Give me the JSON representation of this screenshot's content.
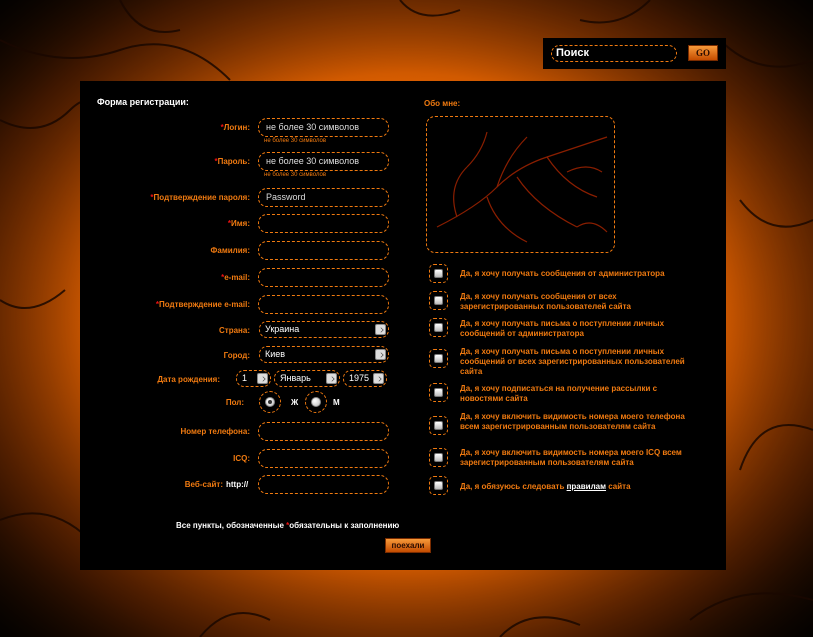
{
  "search": {
    "value": "Поиск",
    "go_label": "GO"
  },
  "form": {
    "title": "Форма регистрации:",
    "login": {
      "label": "Логин:",
      "placeholder": "не более 30 символов",
      "hint": "не более 30 символов"
    },
    "password": {
      "label": "Пароль:",
      "placeholder": "не более 30 символов",
      "hint": "не более 30 символов"
    },
    "password_confirm": {
      "label": "Подтверждение пароля:",
      "value": "Password"
    },
    "name": {
      "label": "Имя:"
    },
    "surname": {
      "label": "Фамилия:"
    },
    "email": {
      "label": "e-mail:"
    },
    "email_confirm": {
      "label": "Подтверждение e-mail:"
    },
    "country": {
      "label": "Страна:",
      "value": "Украина"
    },
    "city": {
      "label": "Город:",
      "value": "Киев"
    },
    "birthdate": {
      "label": "Дата рождения:",
      "day": "1",
      "month": "Январь",
      "year": "1975"
    },
    "gender": {
      "label": "Пол:",
      "female": "Ж",
      "male": "М",
      "selected": "female"
    },
    "phone": {
      "label": "Номер телефона:"
    },
    "icq": {
      "label": "ICQ:"
    },
    "website": {
      "label": "Веб-сайт:",
      "prefix": "http://"
    },
    "required_star": "*",
    "required_note_before": "Все пункты, обозначенные ",
    "required_note_after": "обязательны к заполнению",
    "submit_label": "поехали"
  },
  "about": {
    "label": "Обо мне:"
  },
  "options": [
    "Да, я хочу получать сообщения от администратора",
    "Да, я хочу получать сообщения от всех зарегистрированных пользователей сайта",
    "Да, я хочу получать письма о поступлении личных сообщений от администратора",
    "Да, я хочу получать письма о поступлении личных сообщений от всех зарегистрированных пользователей сайта",
    "Да, я хочу подписаться на получение рассылки с новостями сайта",
    "Да, я хочу включить видимость номера моего телефона всем зарегистрированным пользователям сайта",
    "Да, я хочу включить видимость номера моего ICQ всем зарегистрированным пользователям сайта"
  ],
  "rules_option": {
    "before": "Да, я обязуюсь следовать ",
    "link": "правилам",
    "after": " сайта"
  },
  "colors": {
    "accent": "#f07a10",
    "required": "#e11111",
    "panel": "#000000"
  }
}
